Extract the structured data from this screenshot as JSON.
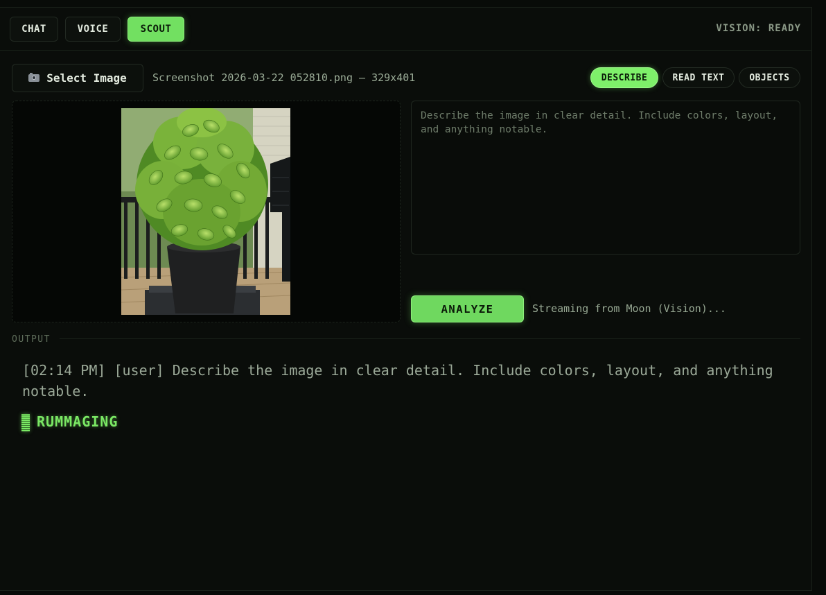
{
  "tabs": [
    {
      "label": "CHAT",
      "active": false
    },
    {
      "label": "VOICE",
      "active": false
    },
    {
      "label": "SCOUT",
      "active": true
    }
  ],
  "vision_status": "VISION: READY",
  "image_panel": {
    "select_label": "Select Image",
    "select_icon": "camera-icon",
    "file_info": "Screenshot 2026-03-22 052810.png — 329x401",
    "preview_alt": ""
  },
  "analysis_modes": [
    {
      "label": "DESCRIBE",
      "active": true
    },
    {
      "label": "READ TEXT",
      "active": false
    },
    {
      "label": "OBJECTS",
      "active": false
    }
  ],
  "prompt": {
    "value": "",
    "placeholder": "Describe the image in clear detail. Include colors, layout, and anything notable."
  },
  "analyze_label": "ANALYZE",
  "stream_status": "Streaming from Moon (Vision)...",
  "output": {
    "label": "OUTPUT",
    "lines": [
      "[02:14 PM] [user] Describe the image in clear detail. Include colors, layout, and anything notable."
    ],
    "live_status": "RUMMAGING"
  },
  "colors": {
    "accent": "#72e061",
    "background": "#0a0d0a",
    "text_muted": "#9ba998"
  }
}
